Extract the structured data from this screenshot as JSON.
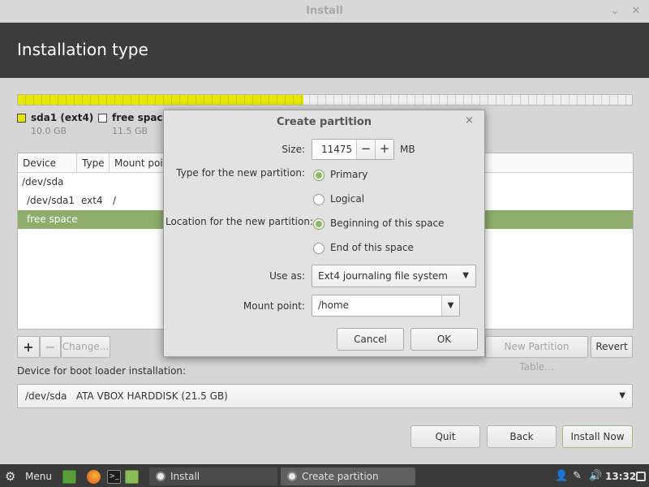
{
  "window": {
    "title": "Install",
    "minimize_glyph": "⌄",
    "close_glyph": "✕"
  },
  "header": {
    "title": "Installation type"
  },
  "partition_bar": {
    "used_fraction": 0.465,
    "used_color": "#e6e600"
  },
  "legend": [
    {
      "name": "sda1 (ext4)",
      "size": "10.0 GB",
      "color": "#e6e600"
    },
    {
      "name": "free space",
      "size": "11.5 GB",
      "color": "#ffffff"
    }
  ],
  "table": {
    "columns": [
      "Device",
      "Type",
      "Mount poir"
    ],
    "rows": [
      {
        "device": "/dev/sda",
        "type": "",
        "mount": ""
      },
      {
        "device": "/dev/sda1",
        "type": "ext4",
        "mount": "/"
      },
      {
        "device": "free space",
        "type": "",
        "mount": ""
      }
    ]
  },
  "table_buttons": {
    "add": "+",
    "remove": "−",
    "change": "Change...",
    "new_table": "New Partition Table...",
    "revert": "Revert"
  },
  "boot": {
    "label": "Device for boot loader installation:",
    "value": "/dev/sda   ATA VBOX HARDDISK (21.5 GB)"
  },
  "bottom_buttons": {
    "quit": "Quit",
    "back": "Back",
    "install": "Install Now"
  },
  "dialog": {
    "title": "Create partition",
    "close_glyph": "×",
    "size_label": "Size:",
    "size_value": "11475",
    "size_unit": "MB",
    "minus": "−",
    "plus": "+",
    "type_label": "Type for the new partition:",
    "type_options": [
      "Primary",
      "Logical"
    ],
    "type_selected": "Primary",
    "location_label": "Location for the new partition:",
    "location_options": [
      "Beginning of this space",
      "End of this space"
    ],
    "location_selected": "Beginning of this space",
    "use_as_label": "Use as:",
    "use_as_value": "Ext4 journaling file system",
    "mount_label": "Mount point:",
    "mount_value": "/home",
    "cancel": "Cancel",
    "ok": "OK"
  },
  "taskbar": {
    "menu": "Menu",
    "windows": [
      {
        "label": "Install",
        "active": false
      },
      {
        "label": "Create partition",
        "active": true
      }
    ],
    "time": "13:32"
  }
}
